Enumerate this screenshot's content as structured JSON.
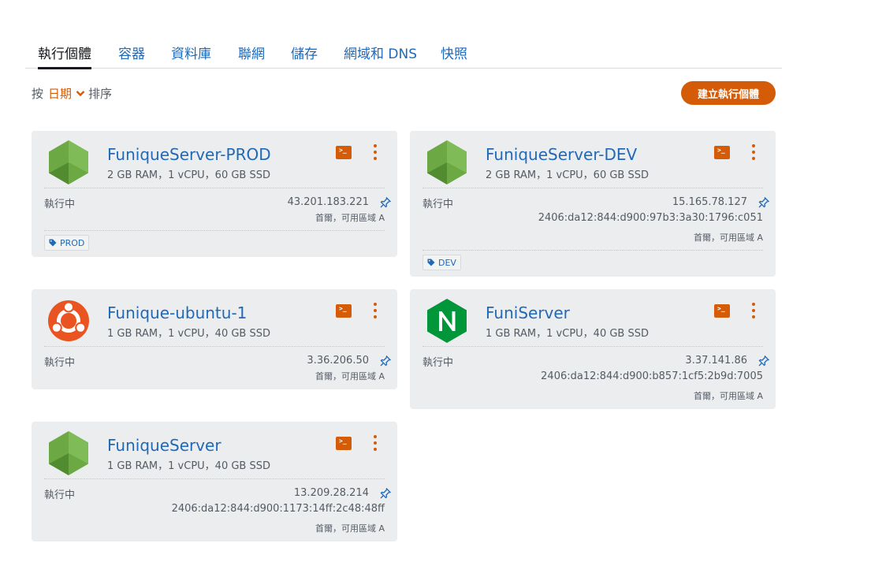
{
  "tabs": [
    "執行個體",
    "容器",
    "資料庫",
    "聯網",
    "儲存",
    "網域和 DNS",
    "快照"
  ],
  "sort": {
    "prefix": "按",
    "value": "日期",
    "suffix": "排序"
  },
  "create_button": "建立執行個體",
  "colors": {
    "accent": "#d45b07",
    "link": "#1f69b8",
    "card_bg": "#ebedef"
  },
  "instances": [
    {
      "name": "FuniqueServer-PROD",
      "logo": "nodejs-icon",
      "specs": "2 GB RAM，1 vCPU，60 GB SSD",
      "status": "執行中",
      "ipv4": "43.201.183.221",
      "ipv6": "",
      "zone": "首爾，可用區域 A",
      "tag": "PROD"
    },
    {
      "name": "FuniqueServer-DEV",
      "logo": "nodejs-icon",
      "specs": "2 GB RAM，1 vCPU，60 GB SSD",
      "status": "執行中",
      "ipv4": "15.165.78.127",
      "ipv6": "2406:da12:844:d900:97b3:3a30:1796:c051",
      "zone": "首爾，可用區域 A",
      "tag": "DEV"
    },
    {
      "name": "Funique-ubuntu-1",
      "logo": "ubuntu-icon",
      "specs": "1 GB RAM，1 vCPU，40 GB SSD",
      "status": "執行中",
      "ipv4": "3.36.206.50",
      "ipv6": "",
      "zone": "首爾，可用區域 A",
      "tag": ""
    },
    {
      "name": "FuniServer",
      "logo": "nginx-icon",
      "specs": "1 GB RAM，1 vCPU，40 GB SSD",
      "status": "執行中",
      "ipv4": "3.37.141.86",
      "ipv6": "2406:da12:844:d900:b857:1cf5:2b9d:7005",
      "zone": "首爾，可用區域 A",
      "tag": ""
    },
    {
      "name": "FuniqueServer",
      "logo": "nodejs-icon",
      "specs": "1 GB RAM，1 vCPU，40 GB SSD",
      "status": "執行中",
      "ipv4": "13.209.28.214",
      "ipv6": "2406:da12:844:d900:1173:14ff:2c48:48ff",
      "zone": "首爾，可用區域 A",
      "tag": ""
    }
  ]
}
